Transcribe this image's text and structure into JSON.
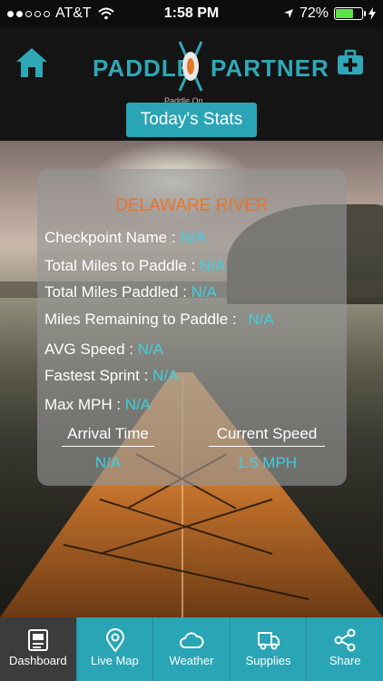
{
  "status_bar": {
    "carrier": "AT&T",
    "time": "1:58 PM",
    "battery": "72%",
    "battery_level": 0.72
  },
  "header": {
    "brand_left": "PADDLE",
    "brand_right": "PARTNER",
    "tagline": "Paddle On.",
    "stats_button": "Today's Stats"
  },
  "card": {
    "river": "DELAWARE RIVER",
    "rows": [
      {
        "label": "Checkpoint Name :",
        "value": "N/A"
      },
      {
        "label": "Total Miles to Paddle :",
        "value": "N/A"
      },
      {
        "label": "Total Miles Paddled :",
        "value": "N/A"
      },
      {
        "label": "Miles Remaining to Paddle :",
        "value": "N/A"
      },
      {
        "label": "AVG Speed :",
        "value": "N/A"
      },
      {
        "label": "Fastest Sprint :",
        "value": "N/A"
      },
      {
        "label": "Max MPH :",
        "value": "N/A"
      }
    ],
    "arrival_label": "Arrival Time",
    "arrival_value": "N/A",
    "speed_label": "Current Speed",
    "speed_value": "1.5 MPH"
  },
  "tabs": [
    {
      "label": "Dashboard",
      "icon": "dashboard-icon"
    },
    {
      "label": "Live Map",
      "icon": "map-pin-icon"
    },
    {
      "label": "Weather",
      "icon": "cloud-icon"
    },
    {
      "label": "Supplies",
      "icon": "truck-icon"
    },
    {
      "label": "Share",
      "icon": "share-icon"
    }
  ],
  "colors": {
    "accent": "#2aa5b6",
    "value_text": "#3fd0e0",
    "river_title": "#e8742a"
  }
}
